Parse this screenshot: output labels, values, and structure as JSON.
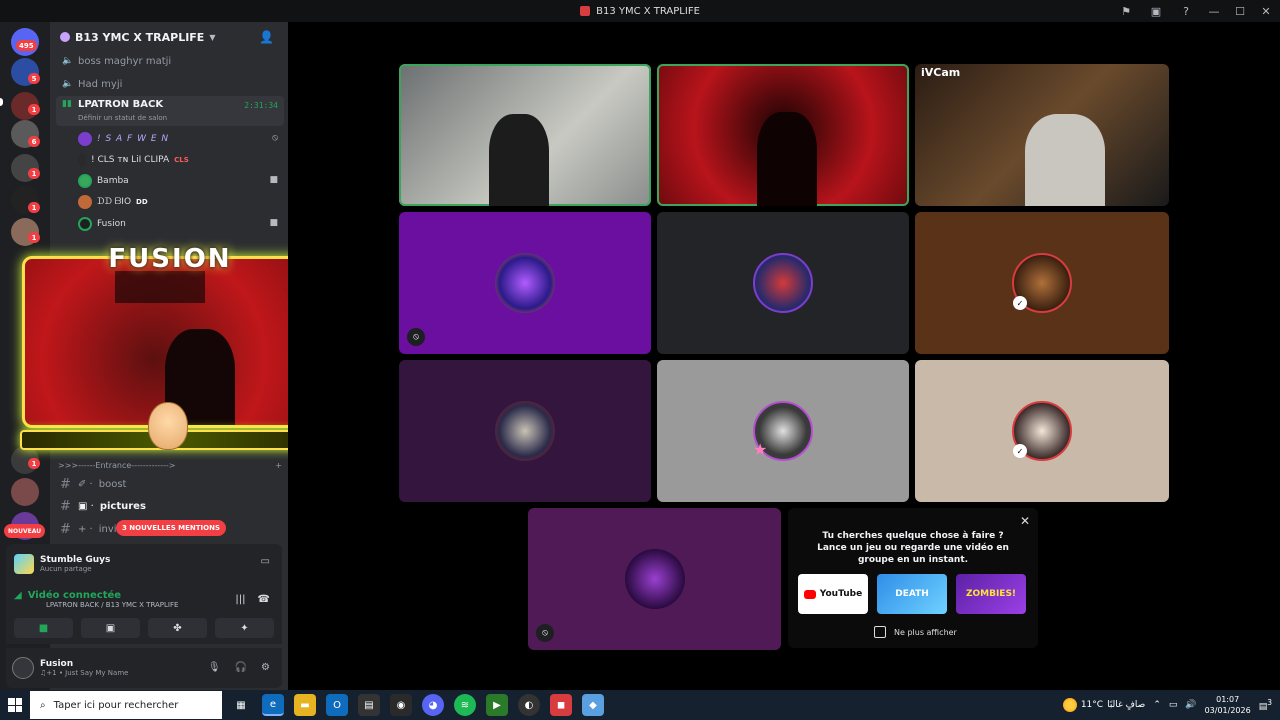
{
  "window": {
    "title": "B13 YMC X TRAPLIFE"
  },
  "rail": {
    "badges": [
      "495",
      "5",
      "1",
      "6",
      "1",
      "1",
      "1",
      "1",
      "1"
    ],
    "nouveau": "NOUVEAU"
  },
  "server": {
    "name": "B13 YMC X TRAPLIFE",
    "voice_channels": [
      {
        "name": "boss maghyr matji"
      },
      {
        "name": "Had myji"
      }
    ],
    "active_channel": {
      "name": "LPATRON BACK",
      "timer": "2:31:34",
      "status": "Définir un statut de salon"
    },
    "voice_users": [
      {
        "name": "! S A F W E N",
        "tag": ""
      },
      {
        "name": "! CLS ᴛɴ LiI CLIPA",
        "tag": "CLS"
      },
      {
        "name": "Bamba",
        "tag": ""
      },
      {
        "name": "ᗪᗪ ᗷIO",
        "tag": "DD"
      },
      {
        "name": "Fusion",
        "tag": ""
      }
    ],
    "category": ">>>------Entrance------------->",
    "text_channels": [
      {
        "prefix": "✐ ·",
        "name": "boost",
        "bold": false
      },
      {
        "prefix": "▣ ·",
        "name": "pictures",
        "bold": true
      },
      {
        "prefix": "+ ·",
        "name": "invi",
        "bold": false
      }
    ],
    "mentions_pill": "3 NOUVELLES MENTIONS"
  },
  "activity": {
    "game": "Stumble Guys",
    "sub": "Aucun partage"
  },
  "voice_connection": {
    "status": "Vidéo connectée",
    "location": "LPATRON BACK / B13 YMC X TRAPLIFE"
  },
  "user": {
    "name": "Fusion",
    "status": "♫+1 • Just Say My Name"
  },
  "overlay": {
    "logo": "FUSION"
  },
  "call": {
    "ivcam_label": "iVCam",
    "card": {
      "question": "Tu cherches quelque chose à faire ?",
      "subtitle": "Lance un jeu ou regarde une vidéo en groupe en un instant.",
      "apps": [
        "YouTube",
        "DEATH",
        "ZOMBIES!"
      ],
      "checkbox": "Ne plus afficher"
    }
  },
  "taskbar": {
    "search_placeholder": "Taper ici pour rechercher",
    "temperature": "11°C",
    "weather": "صافٍ غالبًا",
    "time": "01:07",
    "date": "03/01/2026",
    "notifications": "3"
  },
  "colors": {
    "speaking": "#3ba55c",
    "danger": "#f23f43",
    "accent_yellow": "#ffe04a"
  }
}
